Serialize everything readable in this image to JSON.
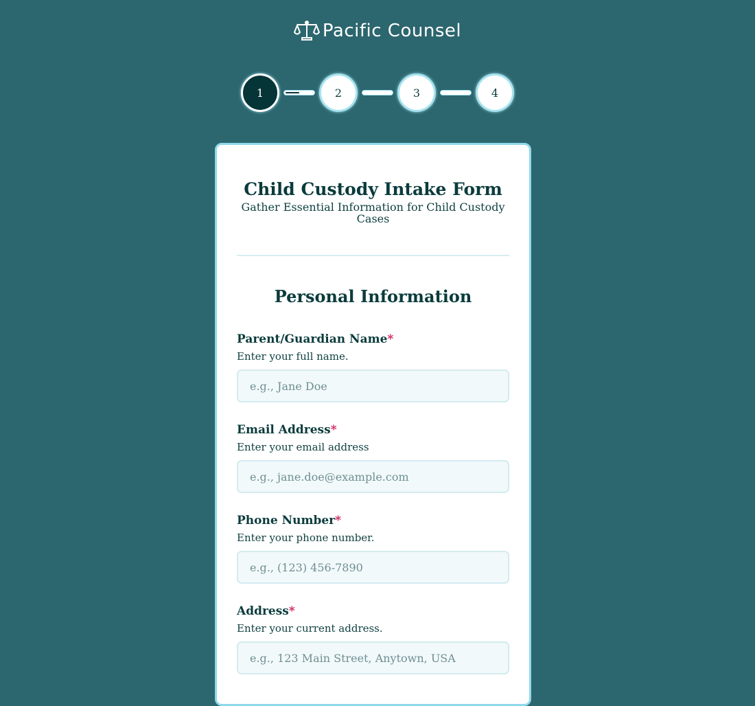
{
  "brand": {
    "name": "Pacific Counsel",
    "icon": "scales-of-justice-icon"
  },
  "stepper": {
    "steps": [
      {
        "label": "1",
        "state": "active"
      },
      {
        "label": "2",
        "state": "upcoming"
      },
      {
        "label": "3",
        "state": "upcoming"
      },
      {
        "label": "4",
        "state": "upcoming"
      }
    ],
    "current_progress_fraction": 0.45
  },
  "form": {
    "title": "Child Custody Intake Form",
    "subtitle": "Gather Essential Information for Child Custody Cases",
    "section_title": "Personal Information",
    "required_marker": "*",
    "fields": [
      {
        "label": "Parent/Guardian Name",
        "help": "Enter your full name.",
        "placeholder": "e.g., Jane Doe",
        "value": ""
      },
      {
        "label": "Email Address",
        "help": "Enter your email address",
        "placeholder": "e.g., jane.doe@example.com",
        "value": ""
      },
      {
        "label": "Phone Number",
        "help": "Enter your phone number.",
        "placeholder": "e.g., (123) 456-7890",
        "value": ""
      },
      {
        "label": "Address",
        "help": "Enter your current address.",
        "placeholder": "e.g., 123 Main Street, Anytown, USA",
        "value": ""
      }
    ]
  },
  "colors": {
    "background": "#2c666e",
    "accent_dark": "#063538",
    "required": "#d11a5a",
    "card_border": "#8fd8ea"
  }
}
